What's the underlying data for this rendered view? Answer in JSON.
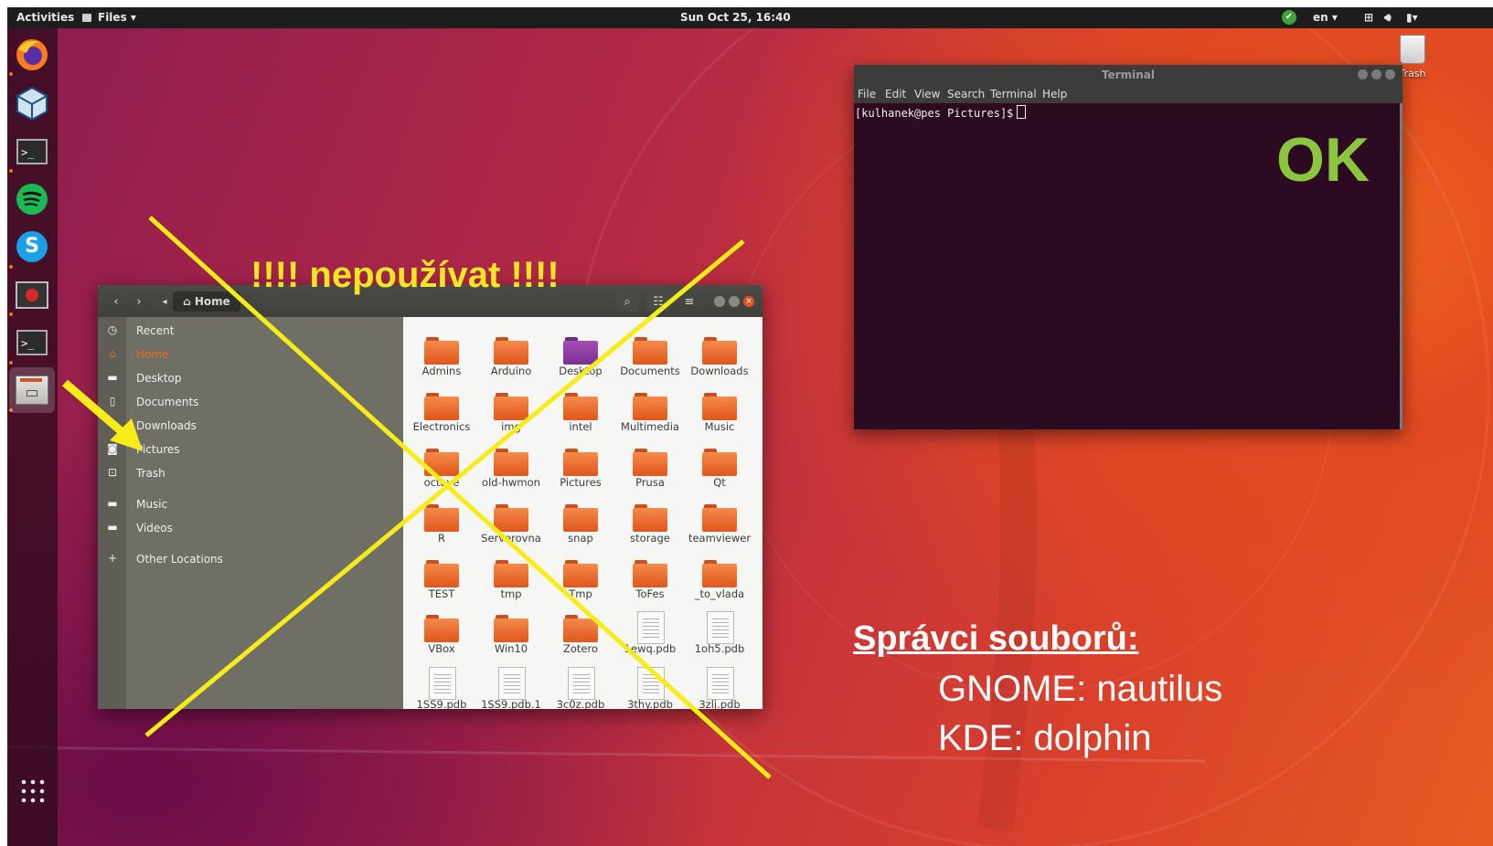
{
  "topbar": {
    "activities": "Activities",
    "app_menu": "Files ▾",
    "clock": "Sun Oct 25, 16:40",
    "lang": "en ▾"
  },
  "dock": {
    "apps": [
      "firefox-icon",
      "virtualbox-icon",
      "terminal-icon",
      "spotify-icon",
      "skype-icon",
      "vm-icon",
      "terminal-icon",
      "files-icon"
    ],
    "show_apps": "show-apps-icon"
  },
  "desktop": {
    "trash_label": "Trash"
  },
  "nautilus": {
    "path_label": "Home",
    "sidebar": [
      {
        "label": "Recent",
        "icon": "clock-icon",
        "active": false
      },
      {
        "label": "Home",
        "icon": "home-icon",
        "active": true
      },
      {
        "label": "Desktop",
        "icon": "folder-icon",
        "active": false
      },
      {
        "label": "Documents",
        "icon": "document-icon",
        "active": false
      },
      {
        "label": "Downloads",
        "icon": "download-icon",
        "active": false
      },
      {
        "label": "Pictures",
        "icon": "camera-icon",
        "active": false
      },
      {
        "label": "Trash",
        "icon": "trash-icon",
        "active": false
      },
      {
        "label": "Music",
        "icon": "folder-icon",
        "active": false
      },
      {
        "label": "Videos",
        "icon": "folder-icon",
        "active": false
      },
      {
        "label": "Other Locations",
        "icon": "plus-icon",
        "active": false
      }
    ],
    "files": [
      {
        "name": "Admins",
        "kind": "folder"
      },
      {
        "name": "Arduino",
        "kind": "folder"
      },
      {
        "name": "Desktop",
        "kind": "desktop"
      },
      {
        "name": "Documents",
        "kind": "folder"
      },
      {
        "name": "Downloads",
        "kind": "folder"
      },
      {
        "name": "Electronics",
        "kind": "folder"
      },
      {
        "name": "img",
        "kind": "folder"
      },
      {
        "name": "intel",
        "kind": "folder"
      },
      {
        "name": "Multimedia",
        "kind": "folder"
      },
      {
        "name": "Music",
        "kind": "folder"
      },
      {
        "name": "octave",
        "kind": "folder"
      },
      {
        "name": "old-hwmon",
        "kind": "folder"
      },
      {
        "name": "Pictures",
        "kind": "folder"
      },
      {
        "name": "Prusa",
        "kind": "folder"
      },
      {
        "name": "Qt",
        "kind": "folder"
      },
      {
        "name": "R",
        "kind": "folder"
      },
      {
        "name": "Serverovna",
        "kind": "folder"
      },
      {
        "name": "snap",
        "kind": "folder"
      },
      {
        "name": "storage",
        "kind": "folder"
      },
      {
        "name": "teamviewer",
        "kind": "folder"
      },
      {
        "name": "TEST",
        "kind": "folder"
      },
      {
        "name": "tmp",
        "kind": "folder"
      },
      {
        "name": "Tmp",
        "kind": "folder"
      },
      {
        "name": "ToFes",
        "kind": "folder"
      },
      {
        "name": "_to_vlada",
        "kind": "folder"
      },
      {
        "name": "VBox",
        "kind": "folder"
      },
      {
        "name": "Win10",
        "kind": "folder"
      },
      {
        "name": "Zotero",
        "kind": "folder"
      },
      {
        "name": "1ewq.pdb",
        "kind": "doc"
      },
      {
        "name": "1oh5.pdb",
        "kind": "doc"
      },
      {
        "name": "1SS9.pdb",
        "kind": "doc"
      },
      {
        "name": "1SS9.pdb.1",
        "kind": "doc"
      },
      {
        "name": "3c0z.pdb",
        "kind": "doc"
      },
      {
        "name": "3thy.pdb",
        "kind": "doc"
      },
      {
        "name": "3zlj.pdb",
        "kind": "doc"
      }
    ]
  },
  "terminal": {
    "title": "Terminal",
    "menu": [
      "File",
      "Edit",
      "View",
      "Search",
      "Terminal",
      "Help"
    ],
    "prompt": "[kulhanek@pes Pictures]$"
  },
  "annotations": {
    "warning": "!!!! nepoužívat !!!!",
    "ok": "OK",
    "heading": "Správci souborů:",
    "line1": "GNOME: nautilus",
    "line2": "KDE: dolphin"
  },
  "colors": {
    "accent": "#f26b21",
    "warning": "#f5e625",
    "ok": "#8cc63f",
    "cross": "#f7ec1a"
  }
}
